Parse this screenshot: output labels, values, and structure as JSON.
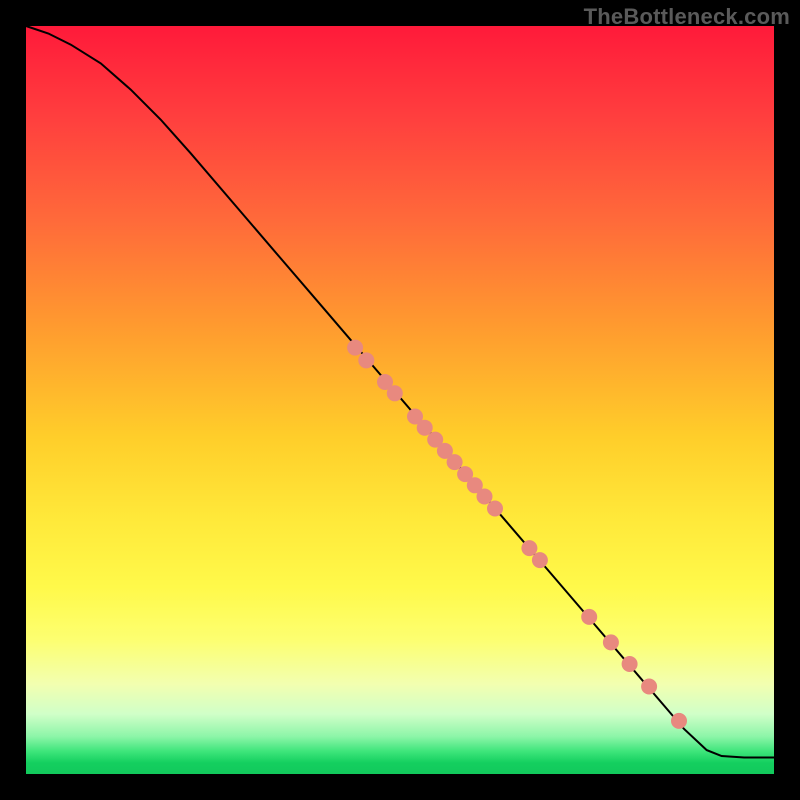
{
  "watermark": "TheBottleneck.com",
  "chart_data": {
    "type": "line",
    "title": "",
    "xlabel": "",
    "ylabel": "",
    "xlim": [
      0,
      100
    ],
    "ylim": [
      0,
      100
    ],
    "grid": false,
    "series": [
      {
        "name": "curve",
        "x": [
          0,
          3,
          6,
          10,
          14,
          18,
          22,
          28,
          34,
          40,
          46,
          52,
          58,
          64,
          70,
          76,
          82,
          88,
          91,
          93,
          96,
          100
        ],
        "y": [
          100,
          99,
          97.5,
          95,
          91.5,
          87.5,
          83,
          76,
          69,
          62,
          55,
          48,
          41,
          34,
          27,
          20,
          13,
          6,
          3.2,
          2.4,
          2.2,
          2.2
        ]
      }
    ],
    "scatter": {
      "name": "markers",
      "points": [
        {
          "x": 44,
          "y": 57
        },
        {
          "x": 45.5,
          "y": 55.3
        },
        {
          "x": 48,
          "y": 52.4
        },
        {
          "x": 49.3,
          "y": 50.9
        },
        {
          "x": 52,
          "y": 47.8
        },
        {
          "x": 53.3,
          "y": 46.3
        },
        {
          "x": 54.7,
          "y": 44.7
        },
        {
          "x": 56,
          "y": 43.2
        },
        {
          "x": 57.3,
          "y": 41.7
        },
        {
          "x": 58.7,
          "y": 40.1
        },
        {
          "x": 60,
          "y": 38.6
        },
        {
          "x": 61.3,
          "y": 37.1
        },
        {
          "x": 62.7,
          "y": 35.5
        },
        {
          "x": 67.3,
          "y": 30.2
        },
        {
          "x": 68.7,
          "y": 28.6
        },
        {
          "x": 75.3,
          "y": 21
        },
        {
          "x": 78.2,
          "y": 17.6
        },
        {
          "x": 80.7,
          "y": 14.7
        },
        {
          "x": 83.3,
          "y": 11.7
        },
        {
          "x": 87.3,
          "y": 7.1
        }
      ]
    },
    "colors": {
      "line": "#000000",
      "marker": "#e8897f",
      "gradient_top": "#ff1a3a",
      "gradient_bottom": "#12c95c"
    }
  }
}
